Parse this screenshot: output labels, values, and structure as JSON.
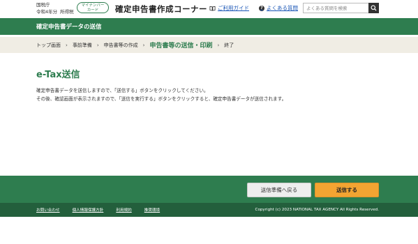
{
  "header": {
    "agency": "国税庁",
    "year": "令和4年分",
    "type": "所得税",
    "mynumber_card": [
      "マイナンバー",
      "カード"
    ],
    "title": "確定申告書作成コーナー",
    "guide_label": "ご利用ガイド",
    "faq_label": "よくある質問",
    "search_placeholder": "よくある質問を検索",
    "icons": {
      "guide": "book-icon",
      "faq": "question-circle-icon",
      "search": "search-icon"
    }
  },
  "page_title_bar": "確定申告書データの送信",
  "breadcrumbs": [
    {
      "label": "トップ画面",
      "active": false
    },
    {
      "label": "事前準備",
      "active": false
    },
    {
      "label": "申告書等の作成",
      "active": false
    },
    {
      "label": "申告書等の送信・印刷",
      "active": true
    },
    {
      "label": "終了",
      "active": false
    }
  ],
  "breadcrumb_separator": "›",
  "main": {
    "heading": "e-Tax送信",
    "paragraphs": [
      "確定申告書データを送信しますので、「送信する」ボタンをクリックしてください。",
      "その後、確認画面が表示されますので、「送信を実行する」ボタンをクリックすると、確定申告書データが送信されます。"
    ]
  },
  "actions": {
    "back_label": "送信準備へ戻る",
    "send_label": "送信する"
  },
  "footer": {
    "links": [
      "お問い合わせ",
      "個人情報保護方針",
      "利用規約",
      "推奨環境"
    ],
    "copyright": "Copyright (c) 2023 NATIONAL TAX AGENCY All Rights Reserved."
  },
  "colors": {
    "brand_green": "#2e7d4f",
    "footer_green": "#235f3c",
    "breadcrumb_bg": "#f0ede4",
    "send_button": "#f3a432",
    "link_blue": "#1a56b6"
  }
}
